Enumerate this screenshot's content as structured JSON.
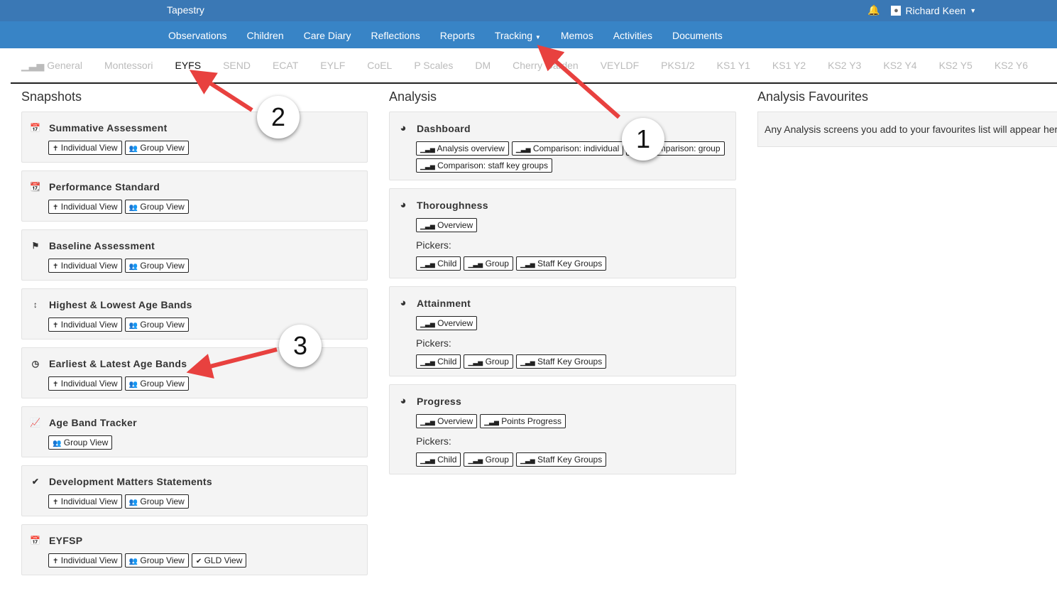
{
  "topbar": {
    "brand": "Tapestry",
    "user": "Richard Keen"
  },
  "nav": [
    "Observations",
    "Children",
    "Care Diary",
    "Reflections",
    "Reports",
    "Tracking",
    "Memos",
    "Activities",
    "Documents"
  ],
  "tabs": [
    "General",
    "Montessori",
    "EYFS",
    "SEND",
    "ECAT",
    "EYLF",
    "CoEL",
    "P Scales",
    "DM",
    "Cherry Garden",
    "VEYLDF",
    "PKS1/2",
    "KS1 Y1",
    "KS1 Y2",
    "KS2 Y3",
    "KS2 Y4",
    "KS2 Y5",
    "KS2 Y6"
  ],
  "snapshots": {
    "heading": "Snapshots",
    "cards": [
      {
        "title": "Summative Assessment",
        "icon": "calendar-icon",
        "buttons": [
          "Individual View",
          "Group View"
        ]
      },
      {
        "title": "Performance Standard",
        "icon": "calendar-check-icon",
        "buttons": [
          "Individual View",
          "Group View"
        ]
      },
      {
        "title": "Baseline Assessment",
        "icon": "flag-icon",
        "buttons": [
          "Individual View",
          "Group View"
        ]
      },
      {
        "title": "Highest & Lowest Age Bands",
        "icon": "arrows-vertical-icon",
        "buttons": [
          "Individual View",
          "Group View"
        ]
      },
      {
        "title": "Earliest & Latest Age Bands",
        "icon": "clock-icon",
        "buttons": [
          "Individual View",
          "Group View"
        ]
      },
      {
        "title": "Age Band Tracker",
        "icon": "line-chart-icon",
        "buttons": [
          "Group View"
        ]
      },
      {
        "title": "Development Matters Statements",
        "icon": "check-circle-icon",
        "buttons": [
          "Individual View",
          "Group View"
        ]
      },
      {
        "title": "EYFSP",
        "icon": "calendar-icon",
        "buttons": [
          "Individual View",
          "Group View",
          "GLD View"
        ]
      }
    ]
  },
  "analysis": {
    "heading": "Analysis",
    "pickers_label": "Pickers:",
    "cards": [
      {
        "title": "Dashboard",
        "buttons": [
          "Analysis overview",
          "Comparison: individual",
          "Comparison: group",
          "Comparison: staff key groups"
        ],
        "pickers": []
      },
      {
        "title": "Thoroughness",
        "buttons": [
          "Overview"
        ],
        "pickers": [
          "Child",
          "Group",
          "Staff Key Groups"
        ]
      },
      {
        "title": "Attainment",
        "buttons": [
          "Overview"
        ],
        "pickers": [
          "Child",
          "Group",
          "Staff Key Groups"
        ]
      },
      {
        "title": "Progress",
        "buttons": [
          "Overview",
          "Points Progress"
        ],
        "pickers": [
          "Child",
          "Group",
          "Staff Key Groups"
        ]
      }
    ]
  },
  "favourites": {
    "heading": "Analysis Favourites",
    "text": "Any Analysis screens you add to your favourites list will appear here"
  },
  "annotations": [
    "1",
    "2",
    "3"
  ],
  "colors": {
    "topbar": "#3a78b5",
    "navbar": "#3884c6",
    "arrow": "#e8413f"
  }
}
